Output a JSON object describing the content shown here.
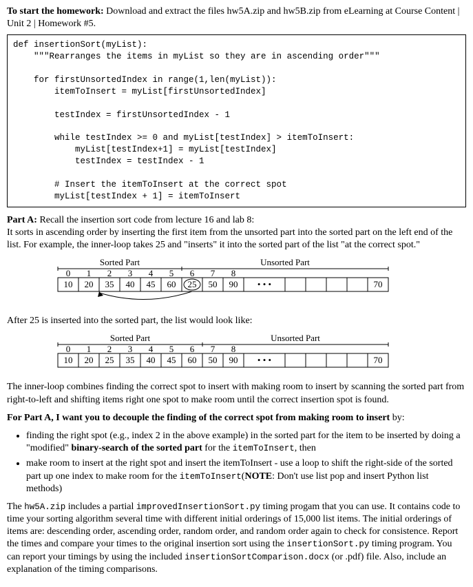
{
  "intro": {
    "lead": "To start the homework:",
    "rest": "  Download and extract the files hw5A.zip and hw5B.zip from eLearning at Course Content | Unit 2 | Homework #5."
  },
  "code_block": "def insertionSort(myList):\n    \"\"\"Rearranges the items in myList so they are in ascending order\"\"\"\n\n    for firstUnsortedIndex in range(1,len(myList)):\n        itemToInsert = myList[firstUnsortedIndex]\n\n        testIndex = firstUnsortedIndex - 1\n\n        while testIndex >= 0 and myList[testIndex] > itemToInsert:\n            myList[testIndex+1] = myList[testIndex]\n            testIndex = testIndex - 1\n\n        # Insert the itemToInsert at the correct spot\n        myList[testIndex + 1] = itemToInsert",
  "partA": {
    "head": "Part A:",
    "head_rest": "  Recall the insertion sort code from lecture 16 and lab 8:",
    "p1": "It sorts in ascending order by inserting the first item from the unsorted part into the sorted part on the left end of the list.  For example, the inner-loop takes 25 and \"inserts\" it into the sorted part of the list \"at the correct spot.\""
  },
  "after_text": "After 25 is inserted into the sorted part, the list would look like:",
  "array1": {
    "sorted_label": "Sorted Part",
    "unsorted_label": "Unsorted Part",
    "indices": [
      "0",
      "1",
      "2",
      "3",
      "4",
      "5",
      "6",
      "7",
      "8"
    ],
    "cells": [
      "10",
      "20",
      "35",
      "40",
      "45",
      "60",
      "25",
      "50",
      "90",
      "•  •  •",
      "",
      "",
      "",
      "",
      "70"
    ],
    "sorted_end_index": 6,
    "circled_index": 6,
    "arrow_from_index": 6,
    "arrow_to_between": 2
  },
  "array2": {
    "sorted_label": "Sorted Part",
    "unsorted_label": "Unsorted Part",
    "indices": [
      "0",
      "1",
      "2",
      "3",
      "4",
      "5",
      "6",
      "7",
      "8"
    ],
    "cells": [
      "10",
      "20",
      "25",
      "35",
      "40",
      "45",
      "60",
      "50",
      "90",
      "•  •  •",
      "",
      "",
      "",
      "",
      "70"
    ],
    "sorted_end_index": 7
  },
  "innerloop_text": "The inner-loop combines finding the correct spot to insert with making room to insert by scanning the sorted part from right-to-left and shifting items right one spot to make room until the correct insertion spot is found.",
  "decouple": {
    "lead": "For Part A, I want you to decouple the finding of the correct spot from making room to insert",
    "by": " by:",
    "b1_a": "finding the right spot (e.g., index 2 in the above example) in the sorted part for the item to be inserted by doing a \"modified\" ",
    "b1_bold": "binary-search of the sorted part",
    "b1_b": " for the ",
    "b1_code": "itemToInsert",
    "b1_c": ", then",
    "b2_a": "make room to insert at the right spot and insert the itemToInsert - use a loop to shift the right-side of the sorted part up one index to make room for the ",
    "b2_code": "itemToInsert",
    "b2_b": "(",
    "b2_bold": "NOTE",
    "b2_c": ": Don't use list pop and insert Python list methods)"
  },
  "closing": {
    "a1": "The ",
    "code1": "hw5A.zip",
    "a2": " includes a partial ",
    "code2": "improvedInsertionSort.py",
    "a3": " timing progam that you can use.  It contains code to time your sorting algorithm several time with different initial orderings of 15,000 list items. The initial orderings of items are: descending order, ascending order, random order, and random order again to check for consistence.  Report the times and compare your times to the original insertion sort using the ",
    "code3": "insertionSort.py",
    "a4": " timing program. You can report your timings by using the included ",
    "code4": "insertionSortComparison.docx",
    "a5": " (or .pdf) file.  Also, include an explanation of the timing comparisons."
  }
}
